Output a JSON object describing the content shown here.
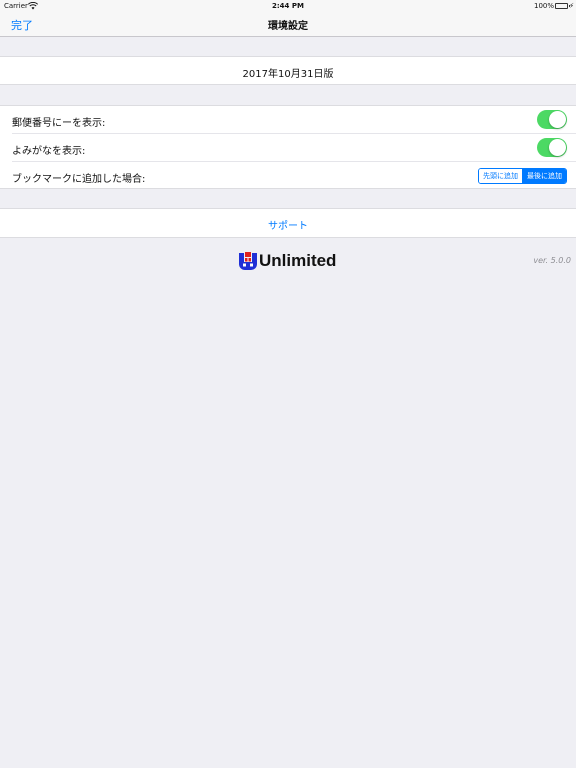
{
  "status_bar": {
    "carrier": "Carrier",
    "time": "2:44 PM",
    "battery_percent": "100%",
    "battery_level": 1.0,
    "charging_glyph": "⚡"
  },
  "nav": {
    "done_label": "完了",
    "title": "環境設定"
  },
  "version_cell": {
    "text": "2017年10月31日版"
  },
  "settings": {
    "rows": [
      {
        "label": "郵便番号にーを表示:",
        "control": "toggle",
        "on": true
      },
      {
        "label": "よみがなを表示:",
        "control": "toggle",
        "on": true
      },
      {
        "label": "ブックマークに追加した場合:",
        "control": "segmented",
        "options": [
          "先頭に追加",
          "最後に追加"
        ],
        "selected_index": 1
      }
    ]
  },
  "support": {
    "label": "サポート"
  },
  "footer": {
    "logo_text": "Unlimited",
    "version": "ver. 5.0.0"
  },
  "colors": {
    "accent": "#007aff",
    "toggle_on": "#4cd964",
    "background": "#efeff4",
    "logo_blue": "#1f2fd6",
    "logo_red": "#e0201e"
  },
  "icons": [
    "wifi-icon",
    "battery-icon",
    "charging-icon",
    "unlimited-logo-icon"
  ]
}
